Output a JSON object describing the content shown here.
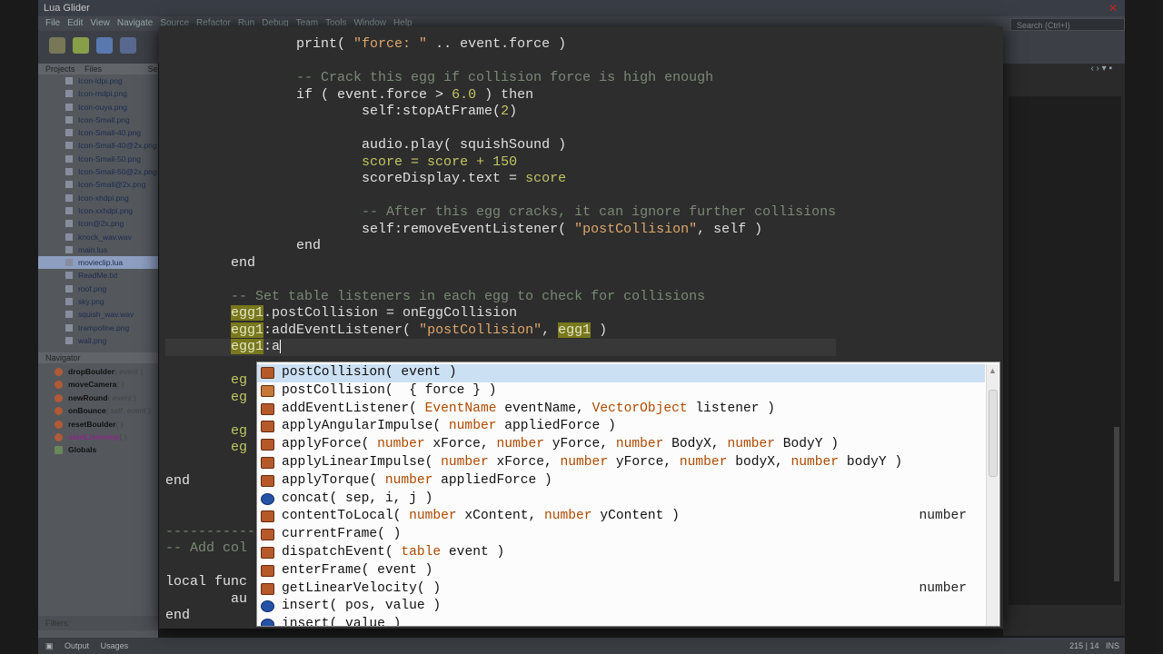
{
  "window": {
    "title": "Lua Glider"
  },
  "menu": [
    "File",
    "Edit",
    "View",
    "Navigate",
    "Source",
    "Refactor",
    "Run",
    "Debug",
    "Team",
    "Tools",
    "Window",
    "Help"
  ],
  "search": {
    "placeholder": "Search (Ctrl+I)"
  },
  "projects": {
    "tabs": [
      "Projects",
      "Files",
      "Se"
    ],
    "files": [
      "Icon-ldpi.png",
      "Icon-mdpi.png",
      "Icon-ouya.png",
      "Icon-Small.png",
      "Icon-Small-40.png",
      "Icon-Small-40@2x.png",
      "Icon-Small-50.png",
      "Icon-Small-50@2x.png",
      "Icon-Small@2x.png",
      "Icon-xhdpi.png",
      "Icon-xxhdpi.png",
      "Icon@2x.png",
      "knock_wav.wav",
      "main.lua",
      "movieclip.lua",
      "ReadMe.txt",
      "roof.png",
      "sky.png",
      "squish_wav.wav",
      "trampoline.png",
      "wall.png"
    ],
    "selected_file": "movieclip.lua"
  },
  "navigator": {
    "title": "Navigator",
    "items": [
      {
        "name": "dropBoulder",
        "args": "( event )"
      },
      {
        "name": "moveCamera",
        "args": "( )"
      },
      {
        "name": "newRound",
        "args": "( event )"
      },
      {
        "name": "onBounce",
        "args": "( self, event )"
      },
      {
        "name": "resetBoulder",
        "args": "( )"
      },
      {
        "name": "startListening",
        "args": "( )"
      },
      {
        "name": "Globals",
        "args": ""
      }
    ]
  },
  "filters_label": "Filters:",
  "statusbar": {
    "output": "Output",
    "usages": "Usages",
    "position": "215 | 14",
    "mode": "INS"
  },
  "code": {
    "lines": [
      {
        "pre": "                print( ",
        "s1": "\"force: \"",
        "mid": " .. event.force )"
      },
      {
        "blank": true
      },
      {
        "comment": "                -- Crack this egg if collision force is high enough"
      },
      {
        "pre": "                if ( event.force > ",
        "num": "6.0",
        "post": " ) then"
      },
      {
        "pre": "                        self:stopAtFrame(",
        "num": "2",
        "post": ")"
      },
      {
        "blank": true
      },
      {
        "pre": "                        audio.play( squishSound )"
      },
      {
        "pre": "                        ",
        "var": "score = score + ",
        "num": "150"
      },
      {
        "pre": "                        scoreDisplay.text = ",
        "var": "score"
      },
      {
        "blank": true
      },
      {
        "comment": "                        -- After this egg cracks, it can ignore further collisions"
      },
      {
        "pre": "                        self:removeEventListener( ",
        "s1": "\"postCollision\"",
        "mid": ", self )"
      },
      {
        "pre": "                end"
      },
      {
        "pre": "        end"
      },
      {
        "blank": true
      },
      {
        "comment": "        -- Set table listeners in each egg to check for collisions"
      },
      {
        "egg": "egg1",
        "post": ".postCollision = onEggCollision"
      },
      {
        "egg": "egg1",
        "post": ":addEventListener( ",
        "s1": "\"postCollision\"",
        "mid": ", ",
        "egg2": "egg1",
        "tail": " )"
      },
      {
        "egg": "egg1",
        "post": ":a",
        "cursor": true
      },
      {
        "blank": true
      },
      {
        "egg_partial": "        eg"
      },
      {
        "egg_partial": "        eg"
      },
      {
        "blank": true
      },
      {
        "egg_partial": "        eg"
      },
      {
        "egg_partial": "        eg"
      },
      {
        "blank": true
      },
      {
        "pre": "end"
      },
      {
        "blank": true
      },
      {
        "blank": true
      },
      {
        "comment": "-----------"
      },
      {
        "comment": "-- Add col"
      },
      {
        "blank": true
      },
      {
        "pre": "local func"
      },
      {
        "pre": "        au"
      },
      {
        "pre": "end"
      }
    ]
  },
  "completion": {
    "items": [
      {
        "icon": "method",
        "name": "postCollision",
        "params": "( event )"
      },
      {
        "icon": "field",
        "name": "postCollision",
        "params": "(  { force } )"
      },
      {
        "icon": "method",
        "name": "addEventListener",
        "params": "( EventName eventName, VectorObject listener )"
      },
      {
        "icon": "method",
        "name": "applyAngularImpulse",
        "params": "( number appliedForce )"
      },
      {
        "icon": "method",
        "name": "applyForce",
        "params": "( number xForce, number yForce, number BodyX, number BodyY )"
      },
      {
        "icon": "method",
        "name": "applyLinearImpulse",
        "params": "( number xForce, number yForce, number bodyX, number bodyY )"
      },
      {
        "icon": "method",
        "name": "applyTorque",
        "params": "( number appliedForce )"
      },
      {
        "icon": "global",
        "name": "concat",
        "params": "( sep, i, j )"
      },
      {
        "icon": "method",
        "name": "contentToLocal",
        "params": "( number xContent, number yContent )",
        "ret": "number"
      },
      {
        "icon": "method",
        "name": "currentFrame",
        "params": "( )"
      },
      {
        "icon": "method",
        "name": "dispatchEvent",
        "params": "( table event )"
      },
      {
        "icon": "method",
        "name": "enterFrame",
        "params": "( event )"
      },
      {
        "icon": "method",
        "name": "getLinearVelocity",
        "params": "( )",
        "ret": "number"
      },
      {
        "icon": "global",
        "name": "insert",
        "params": "( pos, value )"
      },
      {
        "icon": "global",
        "name": "insert",
        "params": "( value )"
      }
    ]
  }
}
